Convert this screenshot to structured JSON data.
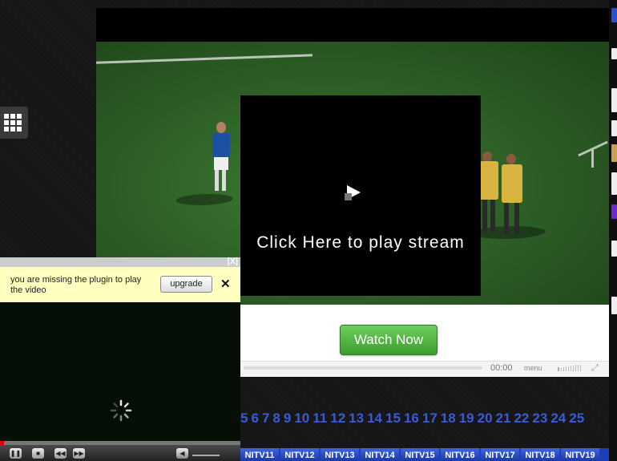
{
  "overlay": {
    "play_text": "Click Here to play stream"
  },
  "watch_panel": {
    "button_label": "Watch Now",
    "time": "00:00",
    "menu_label": "menu"
  },
  "plugin_player": {
    "close_label": "[X]",
    "warning_text": "you are missing the plugin to play the video",
    "upgrade_label": "upgrade",
    "dismiss_label": "✕",
    "progress": 0.015
  },
  "page_numbers": [
    "5",
    "6",
    "7",
    "8",
    "9",
    "10",
    "11",
    "12",
    "13",
    "14",
    "15",
    "16",
    "17",
    "18",
    "19",
    "20",
    "21",
    "22",
    "23",
    "24",
    "25"
  ],
  "channel_tabs": [
    "NITV11",
    "NITV12",
    "NITV13",
    "NITV14",
    "NITV15",
    "NITV16",
    "NITV17",
    "NITV18",
    "NITV19"
  ],
  "colors": {
    "link_blue": "#3b5bd6",
    "tab_blue": "#1d3fb8",
    "watch_green": "#4caf3a",
    "warning_yellow": "#ffffc0"
  }
}
